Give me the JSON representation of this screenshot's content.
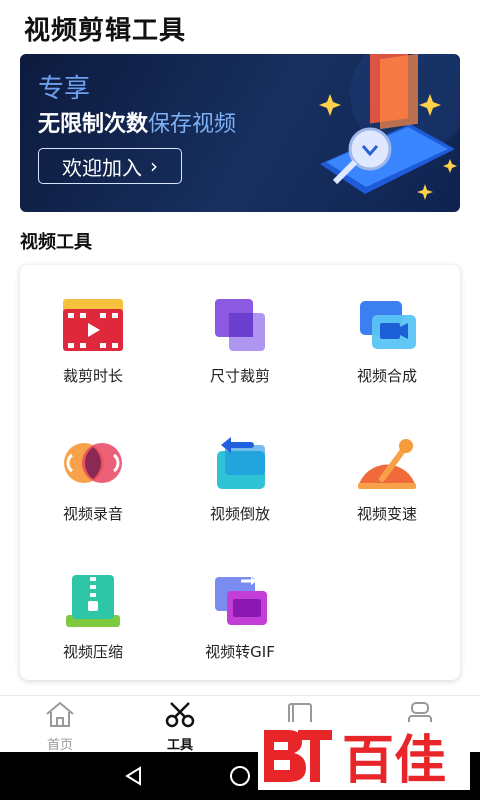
{
  "header": {
    "title": "视频剪辑工具"
  },
  "banner": {
    "tag": "专享",
    "line_main": "无限制次数",
    "line_highlight": "保存视频",
    "button_label": "欢迎加入",
    "button_chevron": "›"
  },
  "section": {
    "title": "视频工具"
  },
  "tools": [
    {
      "label": "裁剪时长",
      "icon": "film-trim-icon"
    },
    {
      "label": "尺寸裁剪",
      "icon": "crop-size-icon"
    },
    {
      "label": "视频合成",
      "icon": "video-merge-icon"
    },
    {
      "label": "视频录音",
      "icon": "audio-record-icon"
    },
    {
      "label": "视频倒放",
      "icon": "reverse-play-icon"
    },
    {
      "label": "视频变速",
      "icon": "speed-dial-icon"
    },
    {
      "label": "视频压缩",
      "icon": "zip-compress-icon"
    },
    {
      "label": "视频转GIF",
      "icon": "gif-convert-icon"
    }
  ],
  "tabbar": {
    "items": [
      {
        "label": "首页",
        "icon": "home-icon",
        "active": false
      },
      {
        "label": "工具",
        "icon": "scissors-icon",
        "active": true
      },
      {
        "label": "",
        "icon": "book-icon",
        "active": false
      },
      {
        "label": "",
        "icon": "profile-icon",
        "active": false
      }
    ]
  },
  "watermark": {
    "text": "百佳",
    "logo": "bt-logo"
  },
  "colors": {
    "banner_bg": "#17305f",
    "banner_highlight": "#7fb0f5",
    "watermark_red": "#e8262a"
  }
}
